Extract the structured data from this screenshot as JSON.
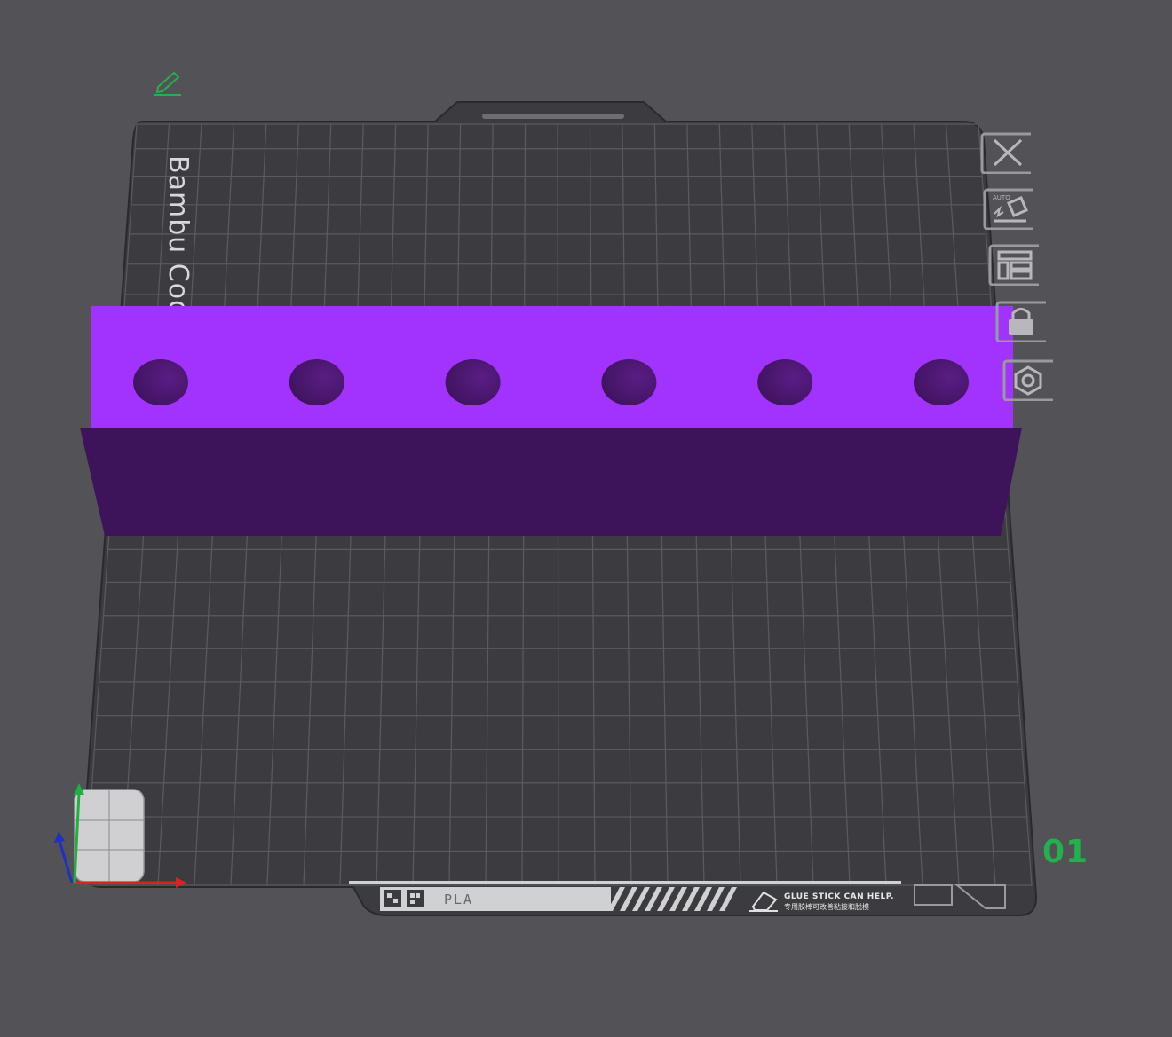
{
  "viewport": {
    "background": "#525257"
  },
  "plate": {
    "number": "01",
    "brand_text": "Bambu Cool P",
    "strip": {
      "filament_label": "PLA",
      "glue_notice": "GLUE STICK CAN HELP.",
      "glue_notice_cn": "专用胶棒可改善粘接和脱模"
    },
    "colors": {
      "plate": "#3c3c40",
      "grid": "#5a5a62",
      "plate_number": "#22b14c"
    }
  },
  "model": {
    "colors": {
      "top": "#a233ff",
      "front": "#3d1459",
      "hole": "#3f135e"
    },
    "hole_count": 6
  },
  "toolbar": {
    "items": [
      {
        "name": "close-plate-button",
        "icon": "close-icon"
      },
      {
        "name": "auto-orient-button",
        "icon": "auto-orient-icon",
        "label": "AUTO"
      },
      {
        "name": "arrange-button",
        "icon": "arrange-icon"
      },
      {
        "name": "lock-plate-button",
        "icon": "lock-icon"
      },
      {
        "name": "plate-settings-button",
        "icon": "gear-icon"
      }
    ]
  },
  "axes": {
    "x_color": "#e02020",
    "y_color": "#20b040",
    "z_color": "#2030c0"
  },
  "edit_icon": {
    "icon": "pencil-icon",
    "color": "#22b14c"
  }
}
